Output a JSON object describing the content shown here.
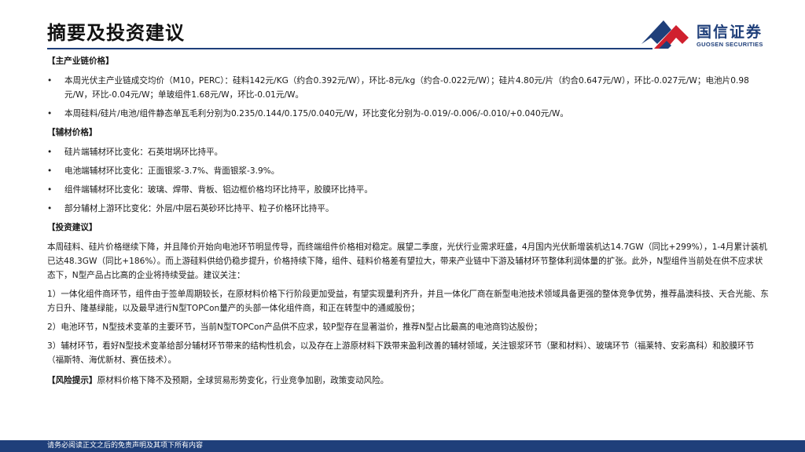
{
  "header": {
    "title": "摘要及投资建议",
    "logo_cn": "国信证券",
    "logo_en": "GUOSEN SECURITIES",
    "colors": {
      "brand_navy": "#1f3f7a",
      "brand_red": "#d0202e"
    }
  },
  "sections": {
    "price_head": "【主产业链价格】",
    "price_bullets": [
      "本周光伏主产业链成交均价（M10，PERC）：硅料142元/KG（约合0.392元/W），环比-8元/kg（约合-0.022元/W）；硅片4.80元/片（约合0.647元/W），环比-0.027元/W；电池片0.98元/W，环比-0.04元/W；单玻组件1.68元/W，环比-0.01元/W。",
      "本周硅料/硅片/电池/组件静态单瓦毛利分别为0.235/0.144/0.175/0.040元/W，环比变化分别为-0.019/-0.006/-0.010/+0.040元/W。"
    ],
    "aux_head": "【辅材价格】",
    "aux_bullets": [
      "硅片端辅材环比变化：石英坩埚环比持平。",
      "电池端辅材环比变化：正面银浆-3.7%、背面银浆-3.9%。",
      "组件端辅材环比变化：玻璃、焊带、背板、铝边框价格均环比持平，胶膜环比持平。",
      "部分辅材上游环比变化：外层/中层石英砂环比持平、粒子价格环比持平。"
    ],
    "invest_head": "【投资建议】",
    "invest_paras": [
      "本周硅料、硅片价格继续下降，并且降价开始向电池环节明显传导，而终端组件价格相对稳定。展望二季度，光伏行业需求旺盛，4月国内光伏新增装机达14.7GW（同比+299%），1-4月累计装机已达48.3GW（同比+186%）。而上游硅料供给仍稳步提升，价格持续下降，组件、硅料价格差有望拉大，带来产业链中下游及辅材环节整体利润体量的扩张。此外，N型组件当前处在供不应求状态下，N型产品占比高的企业将持续受益。建议关注：",
      "1）一体化组件商环节，组件由于签单周期较长，在原材料价格下行阶段更加受益，有望实现量利齐升，并且一体化厂商在新型电池技术领域具备更强的整体竞争优势，推荐晶澳科技、天合光能、东方日升、隆基绿能，以及最早进行N型TOPCon量产的头部一体化组件商，和正在转型中的通威股份；",
      "2）电池环节，N型技术变革的主要环节，当前N型TOPCon产品供不应求，较P型存在显著溢价，推荐N型占比最高的电池商钧达股份；",
      "3）辅材环节，看好N型技术变革给部分辅材环节带来的结构性机会，以及存在上游原材料下跌带来盈利改善的辅材领域，关注银浆环节（聚和材料）、玻璃环节（福莱特、安彩高科）和胶膜环节（福斯特、海优新材、赛伍技术）。"
    ],
    "risk_label": "【风险提示】",
    "risk_text": "原材料价格下降不及预期，全球贸易形势变化，行业竞争加剧，政策变动风险。"
  },
  "footer": {
    "disclaimer": "请务必阅读正文之后的免责声明及其项下所有内容"
  }
}
